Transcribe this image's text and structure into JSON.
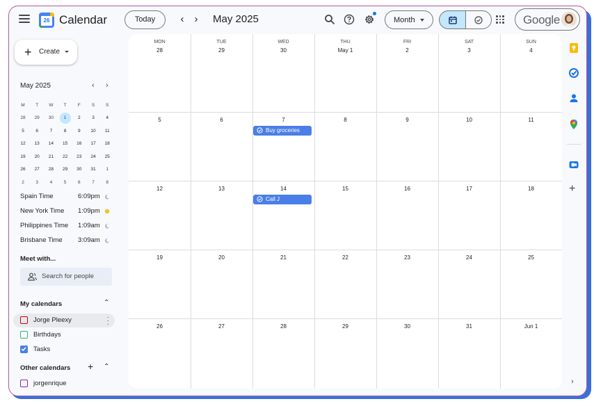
{
  "header": {
    "app_name": "Calendar",
    "logo_day": "26",
    "today_label": "Today",
    "month_title": "May 2025",
    "view_label": "Month",
    "account_brand": "Google"
  },
  "sidebar": {
    "create_label": "Create",
    "mini_calendar": {
      "title": "May 2025",
      "weekdays": [
        "M",
        "T",
        "W",
        "T",
        "F",
        "S",
        "S"
      ],
      "weeks": [
        [
          "28",
          "29",
          "30",
          "1",
          "2",
          "3",
          "4"
        ],
        [
          "5",
          "6",
          "7",
          "8",
          "9",
          "10",
          "11"
        ],
        [
          "12",
          "13",
          "14",
          "15",
          "16",
          "17",
          "18"
        ],
        [
          "19",
          "20",
          "21",
          "22",
          "23",
          "24",
          "25"
        ],
        [
          "26",
          "27",
          "28",
          "29",
          "30",
          "31",
          "1"
        ],
        [
          "2",
          "3",
          "4",
          "5",
          "6",
          "7",
          "8"
        ]
      ],
      "selected_day": "1"
    },
    "time_zones": [
      {
        "label": "Spain Time",
        "time": "6:09pm",
        "icon": "moon-icon"
      },
      {
        "label": "New York Time",
        "time": "1:09pm",
        "icon": "sun-icon"
      },
      {
        "label": "Philippines Time",
        "time": "1:09am",
        "icon": "moon-icon"
      },
      {
        "label": "Brisbane Time",
        "time": "3:09am",
        "icon": "moon-icon"
      }
    ],
    "meet_title": "Meet with...",
    "search_placeholder": "Search for people",
    "my_calendars_title": "My calendars",
    "my_calendars": [
      {
        "label": "Jorge Pleexy",
        "color": "#d50000",
        "checked": false
      },
      {
        "label": "Birthdays",
        "color": "#33b679",
        "checked": false
      },
      {
        "label": "Tasks",
        "color": "#4a7ee8",
        "checked": true
      }
    ],
    "other_calendars_title": "Other calendars",
    "other_calendars": [
      {
        "label": "jorgenrique",
        "color": "#8e24aa",
        "checked": false
      }
    ]
  },
  "grid": {
    "weekdays": [
      "MON",
      "TUE",
      "WED",
      "THU",
      "FRI",
      "SAT",
      "SUN"
    ],
    "weeks": [
      [
        "28",
        "29",
        "30",
        "May 1",
        "2",
        "3",
        "4"
      ],
      [
        "5",
        "6",
        "7",
        "8",
        "9",
        "10",
        "11"
      ],
      [
        "12",
        "13",
        "14",
        "15",
        "16",
        "17",
        "18"
      ],
      [
        "19",
        "20",
        "21",
        "22",
        "23",
        "24",
        "25"
      ],
      [
        "26",
        "27",
        "28",
        "29",
        "30",
        "31",
        "Jun 1"
      ]
    ],
    "events": [
      {
        "label": "Buy groceries",
        "week": 1,
        "day": 2,
        "type": "task"
      },
      {
        "label": "Call J",
        "week": 2,
        "day": 2,
        "type": "task"
      }
    ]
  },
  "colors": {
    "accent": "#1a73e8",
    "event": "#4a7ee8",
    "selected_bg": "#c2e7ff"
  },
  "right_rail": [
    "keep-icon",
    "tasks-icon",
    "contacts-icon",
    "maps-icon",
    "meet-icon"
  ]
}
